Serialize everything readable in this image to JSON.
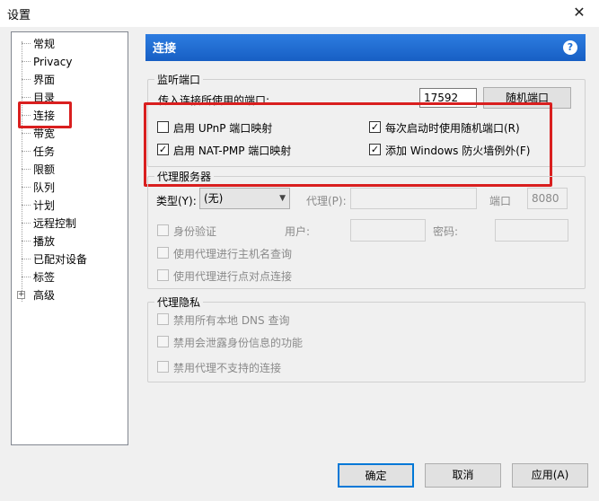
{
  "window": {
    "title": "设置",
    "close_label": "✕"
  },
  "tree": {
    "items": [
      "常规",
      "Privacy",
      "界面",
      "目录",
      "连接",
      "带宽",
      "任务",
      "限额",
      "队列",
      "计划",
      "远程控制",
      "播放",
      "已配对设备",
      "标签",
      "高级"
    ],
    "expander": "+"
  },
  "header": {
    "title": "连接",
    "help": "?"
  },
  "listen": {
    "group_title": "监听端口",
    "port_label": "传入连接所使用的端口:",
    "port_value": "17592",
    "random_button": "随机端口",
    "upnp": "启用 UPnP 端口映射",
    "upnp_checked": false,
    "natpmp": "启用 NAT-PMP 端口映射",
    "natpmp_checked": true,
    "random_on_start": "每次启动时使用随机端口(R)",
    "random_on_start_checked": true,
    "firewall": "添加 Windows 防火墙例外(F)",
    "firewall_checked": true
  },
  "proxy": {
    "group_title": "代理服务器",
    "type_label": "类型(Y):",
    "type_value": "(无)",
    "proxy_label": "代理(P):",
    "port_label": "端口",
    "port_value": "8080",
    "auth": "身份验证",
    "user_label": "用户:",
    "password_label": "密码:",
    "hostname_lookup": "使用代理进行主机名查询",
    "p2p": "使用代理进行点对点连接"
  },
  "privacy": {
    "group_title": "代理隐私",
    "disable_dns": "禁用所有本地 DNS 查询",
    "disable_leak": "禁用会泄露身份信息的功能",
    "disable_unsupported": "禁用代理不支持的连接"
  },
  "footer": {
    "ok": "确定",
    "cancel": "取消",
    "apply": "应用(A)"
  },
  "check_glyph": "✓"
}
